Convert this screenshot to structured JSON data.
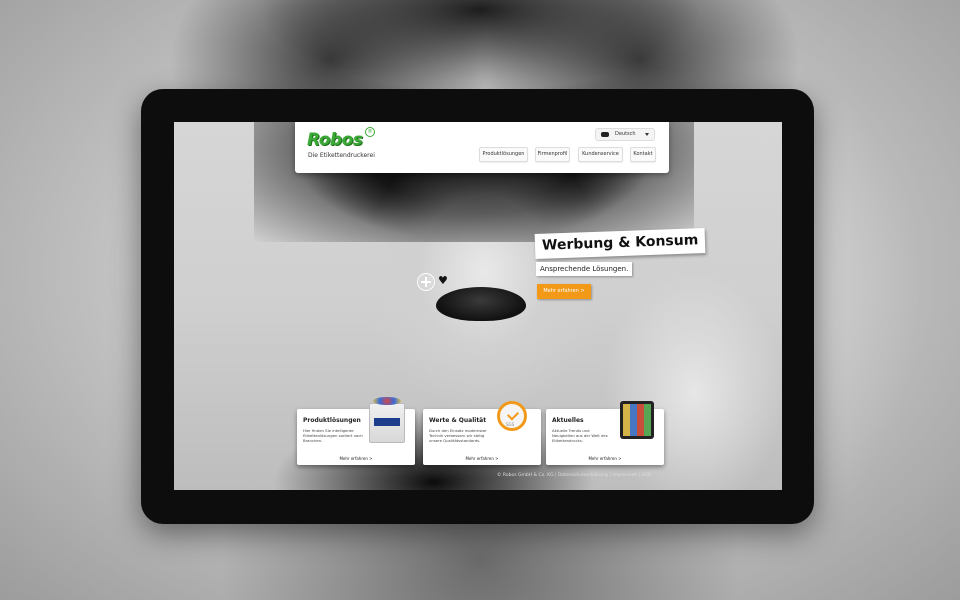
{
  "header": {
    "logo": "Robos",
    "logo_registered": "®",
    "tagline": "Die Etikettendruckerei",
    "language": "Deutsch"
  },
  "nav": {
    "items": [
      {
        "label": "Produktlösungen"
      },
      {
        "label": "Firmenprofil"
      },
      {
        "label": "Kundenservice"
      },
      {
        "label": "Kontakt"
      }
    ]
  },
  "hero": {
    "title": "Werbung & Konsum",
    "subtitle": "Ansprechende Lösungen.",
    "cta": "Mehr erfahren >"
  },
  "cards": [
    {
      "title": "Produktlösungen",
      "text": "Hier finden Sie intelligente Etikettenlösungen sortiert nach Branchen.",
      "link": "Mehr erfahren >",
      "image": "battery-image"
    },
    {
      "title": "Werte & Qualität",
      "text": "Durch den Einsatz modernster Technik verbessern wir stetig unsere Qualitätsstandards.",
      "link": "Mehr erfahren >",
      "image": "sgs-badge-image"
    },
    {
      "title": "Aktuelles",
      "text": "Aktuelle Trends und Neuigkeiten aus der Welt des Etikettendrucks.",
      "link": "Mehr erfahren >",
      "image": "tablet-image"
    }
  ],
  "footer": {
    "text": "© Robos GmbH & Co. KG | Datenschutzerklärung | Impressum | AGB"
  }
}
